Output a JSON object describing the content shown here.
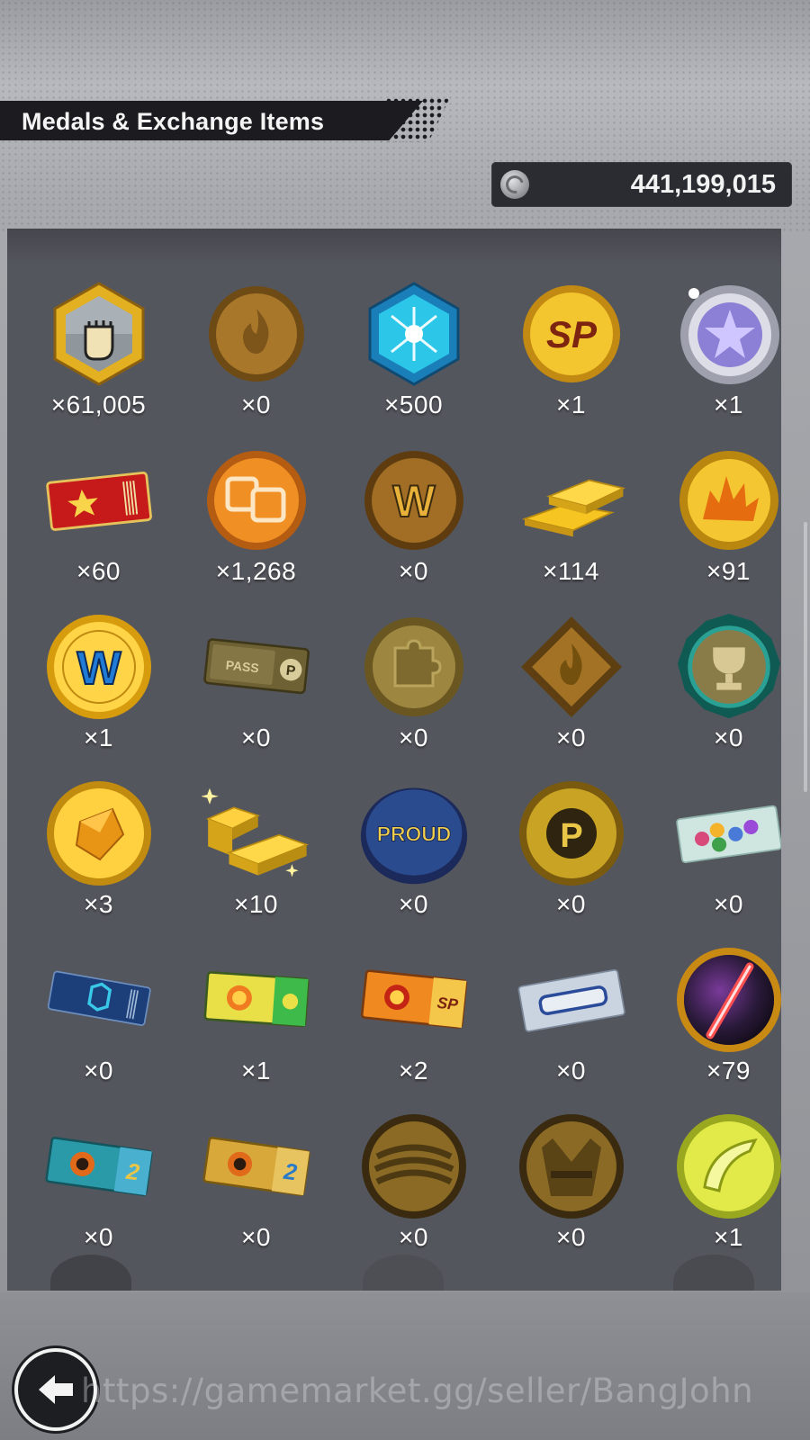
{
  "header": {
    "title": "Medals & Exchange Items"
  },
  "currency": {
    "icon": "coin-icon",
    "value": "441,199,015"
  },
  "items": [
    {
      "name": "fist-hexagon-medal",
      "count": "×61,005"
    },
    {
      "name": "bronze-flame-medal",
      "count": "×0"
    },
    {
      "name": "blue-crystal-hexagon",
      "count": "×500"
    },
    {
      "name": "sp-gold-medal",
      "count": "×1"
    },
    {
      "name": "silver-star-medal",
      "count": "×1"
    },
    {
      "name": "red-star-ticket",
      "count": "×60"
    },
    {
      "name": "orange-card-medal",
      "count": "×1,268"
    },
    {
      "name": "bronze-w-medal",
      "count": "×0"
    },
    {
      "name": "gold-bars",
      "count": "×114"
    },
    {
      "name": "gold-burst-medal",
      "count": "×91"
    },
    {
      "name": "gold-w-medal",
      "count": "×1"
    },
    {
      "name": "pass-ticket",
      "count": "×0"
    },
    {
      "name": "bronze-puzzle-medal",
      "count": "×0"
    },
    {
      "name": "bronze-flame-diamond",
      "count": "×0"
    },
    {
      "name": "green-trophy-medal",
      "count": "×0"
    },
    {
      "name": "gold-crystal-medal",
      "count": "×3"
    },
    {
      "name": "sparkling-gold-bars",
      "count": "×10"
    },
    {
      "name": "proud-badge",
      "count": "×0"
    },
    {
      "name": "gold-p-medal",
      "count": "×0"
    },
    {
      "name": "gem-ticket",
      "count": "×0"
    },
    {
      "name": "blue-ticket",
      "count": "×0"
    },
    {
      "name": "green-fire-ticket",
      "count": "×1"
    },
    {
      "name": "sp-fire-ticket",
      "count": "×2"
    },
    {
      "name": "silver-blank-ticket",
      "count": "×0"
    },
    {
      "name": "red-light-medal",
      "count": "×79"
    },
    {
      "name": "blue-ball-ticket",
      "count": "×0"
    },
    {
      "name": "gold-ball-ticket",
      "count": "×0"
    },
    {
      "name": "bronze-bandage-medal",
      "count": "×0"
    },
    {
      "name": "bronze-gi-medal",
      "count": "×0"
    },
    {
      "name": "lime-cape-medal",
      "count": "×1"
    }
  ],
  "watermark": "https://gamemarket.gg/seller/BangJohn",
  "colors": {
    "gold": "#e8b923",
    "bronze": "#8a6322",
    "panel": "#54565d"
  }
}
